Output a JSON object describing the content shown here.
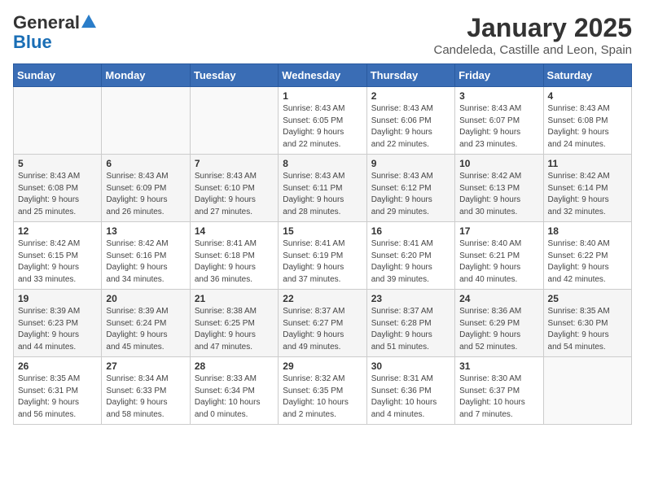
{
  "header": {
    "logo_general": "General",
    "logo_blue": "Blue",
    "month": "January 2025",
    "location": "Candeleda, Castille and Leon, Spain"
  },
  "days_of_week": [
    "Sunday",
    "Monday",
    "Tuesday",
    "Wednesday",
    "Thursday",
    "Friday",
    "Saturday"
  ],
  "weeks": [
    [
      {
        "day": "",
        "info": ""
      },
      {
        "day": "",
        "info": ""
      },
      {
        "day": "",
        "info": ""
      },
      {
        "day": "1",
        "info": "Sunrise: 8:43 AM\nSunset: 6:05 PM\nDaylight: 9 hours\nand 22 minutes."
      },
      {
        "day": "2",
        "info": "Sunrise: 8:43 AM\nSunset: 6:06 PM\nDaylight: 9 hours\nand 22 minutes."
      },
      {
        "day": "3",
        "info": "Sunrise: 8:43 AM\nSunset: 6:07 PM\nDaylight: 9 hours\nand 23 minutes."
      },
      {
        "day": "4",
        "info": "Sunrise: 8:43 AM\nSunset: 6:08 PM\nDaylight: 9 hours\nand 24 minutes."
      }
    ],
    [
      {
        "day": "5",
        "info": "Sunrise: 8:43 AM\nSunset: 6:08 PM\nDaylight: 9 hours\nand 25 minutes."
      },
      {
        "day": "6",
        "info": "Sunrise: 8:43 AM\nSunset: 6:09 PM\nDaylight: 9 hours\nand 26 minutes."
      },
      {
        "day": "7",
        "info": "Sunrise: 8:43 AM\nSunset: 6:10 PM\nDaylight: 9 hours\nand 27 minutes."
      },
      {
        "day": "8",
        "info": "Sunrise: 8:43 AM\nSunset: 6:11 PM\nDaylight: 9 hours\nand 28 minutes."
      },
      {
        "day": "9",
        "info": "Sunrise: 8:43 AM\nSunset: 6:12 PM\nDaylight: 9 hours\nand 29 minutes."
      },
      {
        "day": "10",
        "info": "Sunrise: 8:42 AM\nSunset: 6:13 PM\nDaylight: 9 hours\nand 30 minutes."
      },
      {
        "day": "11",
        "info": "Sunrise: 8:42 AM\nSunset: 6:14 PM\nDaylight: 9 hours\nand 32 minutes."
      }
    ],
    [
      {
        "day": "12",
        "info": "Sunrise: 8:42 AM\nSunset: 6:15 PM\nDaylight: 9 hours\nand 33 minutes."
      },
      {
        "day": "13",
        "info": "Sunrise: 8:42 AM\nSunset: 6:16 PM\nDaylight: 9 hours\nand 34 minutes."
      },
      {
        "day": "14",
        "info": "Sunrise: 8:41 AM\nSunset: 6:18 PM\nDaylight: 9 hours\nand 36 minutes."
      },
      {
        "day": "15",
        "info": "Sunrise: 8:41 AM\nSunset: 6:19 PM\nDaylight: 9 hours\nand 37 minutes."
      },
      {
        "day": "16",
        "info": "Sunrise: 8:41 AM\nSunset: 6:20 PM\nDaylight: 9 hours\nand 39 minutes."
      },
      {
        "day": "17",
        "info": "Sunrise: 8:40 AM\nSunset: 6:21 PM\nDaylight: 9 hours\nand 40 minutes."
      },
      {
        "day": "18",
        "info": "Sunrise: 8:40 AM\nSunset: 6:22 PM\nDaylight: 9 hours\nand 42 minutes."
      }
    ],
    [
      {
        "day": "19",
        "info": "Sunrise: 8:39 AM\nSunset: 6:23 PM\nDaylight: 9 hours\nand 44 minutes."
      },
      {
        "day": "20",
        "info": "Sunrise: 8:39 AM\nSunset: 6:24 PM\nDaylight: 9 hours\nand 45 minutes."
      },
      {
        "day": "21",
        "info": "Sunrise: 8:38 AM\nSunset: 6:25 PM\nDaylight: 9 hours\nand 47 minutes."
      },
      {
        "day": "22",
        "info": "Sunrise: 8:37 AM\nSunset: 6:27 PM\nDaylight: 9 hours\nand 49 minutes."
      },
      {
        "day": "23",
        "info": "Sunrise: 8:37 AM\nSunset: 6:28 PM\nDaylight: 9 hours\nand 51 minutes."
      },
      {
        "day": "24",
        "info": "Sunrise: 8:36 AM\nSunset: 6:29 PM\nDaylight: 9 hours\nand 52 minutes."
      },
      {
        "day": "25",
        "info": "Sunrise: 8:35 AM\nSunset: 6:30 PM\nDaylight: 9 hours\nand 54 minutes."
      }
    ],
    [
      {
        "day": "26",
        "info": "Sunrise: 8:35 AM\nSunset: 6:31 PM\nDaylight: 9 hours\nand 56 minutes."
      },
      {
        "day": "27",
        "info": "Sunrise: 8:34 AM\nSunset: 6:33 PM\nDaylight: 9 hours\nand 58 minutes."
      },
      {
        "day": "28",
        "info": "Sunrise: 8:33 AM\nSunset: 6:34 PM\nDaylight: 10 hours\nand 0 minutes."
      },
      {
        "day": "29",
        "info": "Sunrise: 8:32 AM\nSunset: 6:35 PM\nDaylight: 10 hours\nand 2 minutes."
      },
      {
        "day": "30",
        "info": "Sunrise: 8:31 AM\nSunset: 6:36 PM\nDaylight: 10 hours\nand 4 minutes."
      },
      {
        "day": "31",
        "info": "Sunrise: 8:30 AM\nSunset: 6:37 PM\nDaylight: 10 hours\nand 7 minutes."
      },
      {
        "day": "",
        "info": ""
      }
    ]
  ]
}
